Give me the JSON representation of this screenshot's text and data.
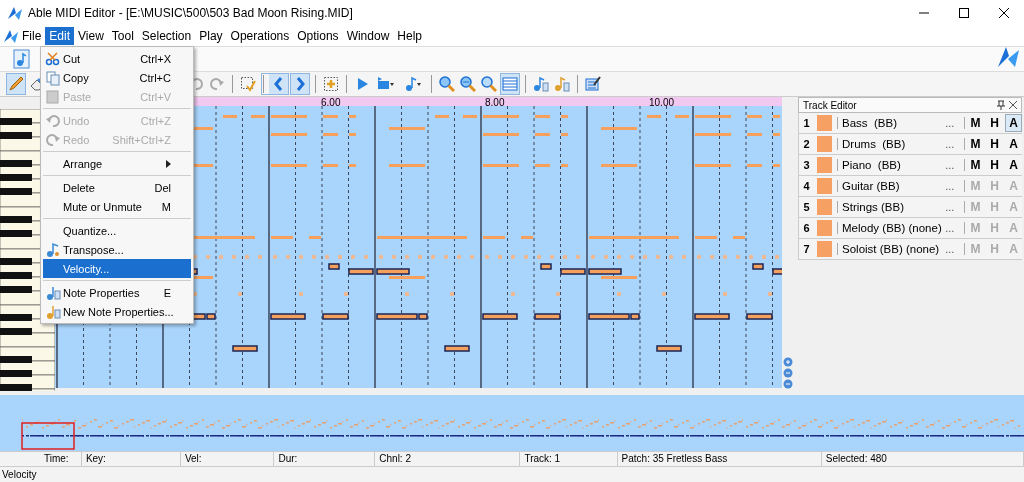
{
  "window": {
    "title": "Able MIDI Editor - [E:\\MUSIC\\500\\503 Bad Moon Rising.MID]"
  },
  "menu": [
    {
      "label": "File",
      "selected": false
    },
    {
      "label": "Edit",
      "selected": true
    },
    {
      "label": "View",
      "selected": false
    },
    {
      "label": "Tool",
      "selected": false
    },
    {
      "label": "Selection",
      "selected": false
    },
    {
      "label": "Play",
      "selected": false
    },
    {
      "label": "Operations",
      "selected": false
    },
    {
      "label": "Options",
      "selected": false
    },
    {
      "label": "Window",
      "selected": false
    },
    {
      "label": "Help",
      "selected": false
    }
  ],
  "edit_menu": [
    [
      {
        "kind": "cut",
        "label": "Cut",
        "shortcut": "Ctrl+X",
        "disabled": false,
        "selected": false
      },
      {
        "kind": "copy",
        "label": "Copy",
        "shortcut": "Ctrl+C",
        "disabled": false,
        "selected": false
      },
      {
        "kind": "paste",
        "label": "Paste",
        "shortcut": "Ctrl+V",
        "disabled": true,
        "selected": false
      }
    ],
    [
      {
        "kind": "undo",
        "label": "Undo",
        "shortcut": "Ctrl+Z",
        "disabled": true,
        "selected": false
      },
      {
        "kind": "redo",
        "label": "Redo",
        "shortcut": "Shift+Ctrl+Z",
        "disabled": true,
        "selected": false
      }
    ],
    [
      {
        "kind": "submenu",
        "label": "Arrange",
        "disabled": false,
        "selected": false
      }
    ],
    [
      {
        "kind": "plain",
        "label": "Delete",
        "shortcut": "Del",
        "disabled": false,
        "selected": false
      },
      {
        "kind": "plain",
        "label": "Mute or Unmute",
        "shortcut": "M",
        "disabled": false,
        "selected": false
      }
    ],
    [
      {
        "kind": "plain",
        "label": "Quantize...",
        "disabled": false,
        "selected": false
      },
      {
        "kind": "transpose",
        "label": "Transpose...",
        "disabled": false,
        "selected": false
      },
      {
        "kind": "plain",
        "label": "Velocity...",
        "disabled": false,
        "selected": true
      }
    ],
    [
      {
        "kind": "note",
        "label": "Note Properties",
        "shortcut": "E",
        "disabled": false,
        "selected": false
      },
      {
        "kind": "new-note",
        "label": "New Note Properties...",
        "disabled": false,
        "selected": false
      }
    ]
  ],
  "toolbar": [
    {
      "kind": "pencil",
      "selected": true,
      "separator_before": false
    },
    {
      "kind": "eraser",
      "selected": false,
      "separator_before": false
    },
    {
      "kind": "undo",
      "selected": false,
      "separator_before": false,
      "offset": true
    },
    {
      "kind": "redo",
      "selected": false,
      "separator_before": false
    },
    {
      "kind": "select",
      "selected": false,
      "separator_before": true
    },
    {
      "kind": "left",
      "selected": true,
      "separator_before": true
    },
    {
      "kind": "right",
      "selected": true,
      "separator_before": false
    },
    {
      "kind": "add",
      "selected": false,
      "separator_before": true
    },
    {
      "kind": "play",
      "selected": false,
      "separator_before": true
    },
    {
      "kind": "loop",
      "selected": false,
      "separator_before": false
    },
    {
      "kind": "notedrop",
      "selected": false,
      "separator_before": false
    },
    {
      "kind": "zoomin",
      "selected": false,
      "separator_before": true
    },
    {
      "kind": "zoomout",
      "selected": false,
      "separator_before": false
    },
    {
      "kind": "zoomfit",
      "selected": false,
      "separator_before": false
    },
    {
      "kind": "grid",
      "selected": true,
      "separator_before": false
    },
    {
      "kind": "notes",
      "selected": false,
      "separator_before": true
    },
    {
      "kind": "notes2",
      "selected": false,
      "separator_before": false
    },
    {
      "kind": "edit",
      "selected": false,
      "separator_before": true
    }
  ],
  "ruler": {
    "labels": [
      "6.00",
      "8.00",
      "10.00"
    ]
  },
  "track_editor": {
    "title": "Track Editor",
    "tracks": [
      {
        "number": "1",
        "color": "#f7a063",
        "name": "Bass  (BB)",
        "more": "...",
        "disabled": false,
        "buttons": [
          {
            "label": "M",
            "selected": false
          },
          {
            "label": "H",
            "selected": false
          },
          {
            "label": "A",
            "selected": true
          }
        ]
      },
      {
        "number": "2",
        "color": "#f7a063",
        "name": "Drums  (BB)",
        "more": "...",
        "disabled": false,
        "buttons": [
          {
            "label": "M",
            "selected": false
          },
          {
            "label": "H",
            "selected": false
          },
          {
            "label": "A",
            "selected": false
          }
        ]
      },
      {
        "number": "3",
        "color": "#f7a063",
        "name": "Piano  (BB)",
        "more": "...",
        "disabled": false,
        "buttons": [
          {
            "label": "M",
            "selected": false
          },
          {
            "label": "H",
            "selected": false
          },
          {
            "label": "A",
            "selected": false
          }
        ]
      },
      {
        "number": "4",
        "color": "#f7a063",
        "name": "Guitar (BB)",
        "more": "...",
        "disabled": true,
        "buttons": [
          {
            "label": "M",
            "selected": false
          },
          {
            "label": "H",
            "selected": false
          },
          {
            "label": "A",
            "selected": false
          }
        ]
      },
      {
        "number": "5",
        "color": "#f7a063",
        "name": "Strings (BB)",
        "more": "...",
        "disabled": true,
        "buttons": [
          {
            "label": "M",
            "selected": false
          },
          {
            "label": "H",
            "selected": false
          },
          {
            "label": "A",
            "selected": false
          }
        ]
      },
      {
        "number": "6",
        "color": "#f7a063",
        "name": "Melody (BB) (none)",
        "more": "...",
        "disabled": true,
        "buttons": [
          {
            "label": "M",
            "selected": false
          },
          {
            "label": "H",
            "selected": false
          },
          {
            "label": "A",
            "selected": false
          }
        ]
      },
      {
        "number": "7",
        "color": "#f7a063",
        "name": "Soloist (BB) (none)",
        "more": "...",
        "disabled": true,
        "buttons": [
          {
            "label": "M",
            "selected": false
          },
          {
            "label": "H",
            "selected": false
          },
          {
            "label": "A",
            "selected": false
          }
        ]
      }
    ]
  },
  "status_bar": [
    "Time:",
    "Key:",
    "Vel:",
    "Dur:",
    "Chnl: 2",
    "Track: 1",
    "Patch: 35 Fretless Bass",
    "Selected: 480"
  ],
  "footer": "Velocity"
}
